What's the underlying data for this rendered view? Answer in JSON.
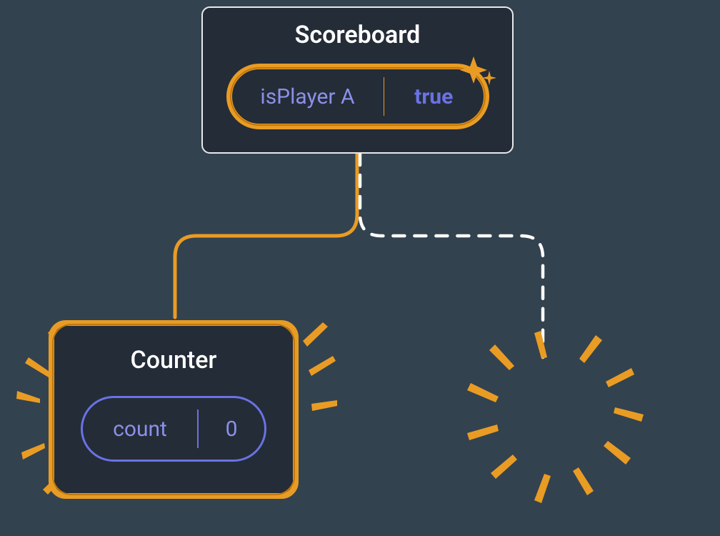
{
  "scoreboard": {
    "title": "Scoreboard",
    "state_name": "isPlayer A",
    "state_value": "true"
  },
  "counter": {
    "title": "Counter",
    "state_name": "count",
    "state_value": "0"
  },
  "colors": {
    "highlight": "#e99c24",
    "panel_bg": "#242c37",
    "page_bg": "#33424f",
    "state_key": "#8b90e9",
    "state_val": "#6a72e5"
  }
}
